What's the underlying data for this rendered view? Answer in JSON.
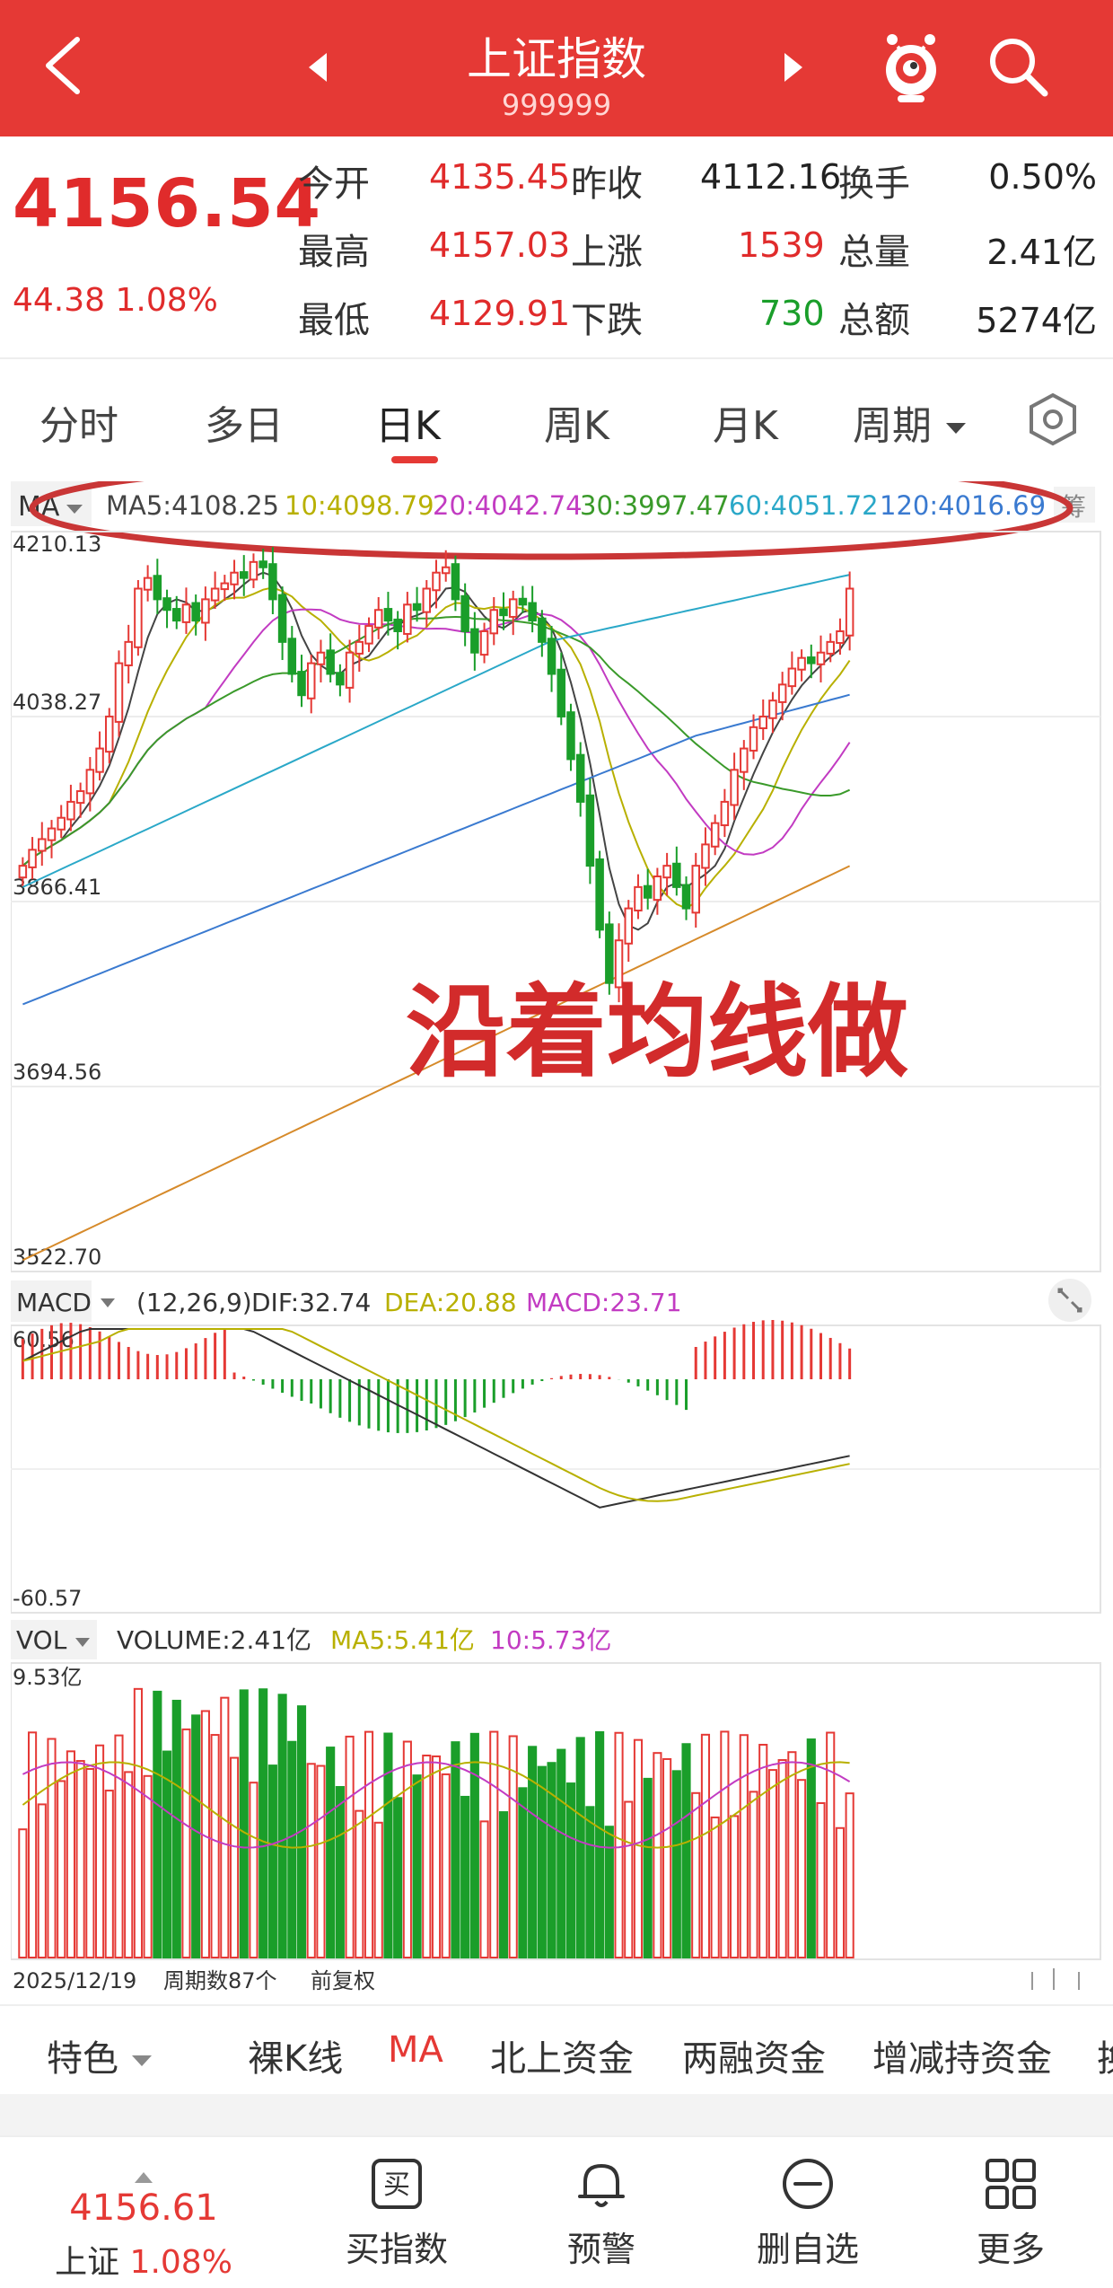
{
  "header": {
    "title": "上证指数",
    "code": "999999"
  },
  "quote": {
    "price": "4156.54",
    "change": "44.38 1.08%",
    "rows": [
      [
        {
          "label": "今开",
          "value": "4135.45",
          "color": "red"
        },
        {
          "label": "昨收",
          "value": "4112.16",
          "color": "dark"
        },
        {
          "label": "换手",
          "value": "0.50%",
          "color": "dark"
        }
      ],
      [
        {
          "label": "最高",
          "value": "4157.03",
          "color": "red"
        },
        {
          "label": "上涨",
          "value": "1539",
          "color": "red"
        },
        {
          "label": "总量",
          "value": "2.41亿",
          "color": "dark"
        }
      ],
      [
        {
          "label": "最低",
          "value": "4129.91",
          "color": "red"
        },
        {
          "label": "下跌",
          "value": "730",
          "color": "green"
        },
        {
          "label": "总额",
          "value": "5274亿",
          "color": "dark"
        }
      ]
    ]
  },
  "tabs": [
    "分时",
    "多日",
    "日K",
    "周K",
    "月K",
    "周期"
  ],
  "active_tab": "日K",
  "ma_legend": {
    "selector": "MA",
    "items": [
      "MA5:4108.25",
      "10:4098.79",
      "20:4042.74",
      "30:3997.47",
      "60:4051.72",
      "120:4016.69"
    ],
    "colors": [
      "#444444",
      "#b8b000",
      "#c23bc2",
      "#3a9a2a",
      "#2aa8c8",
      "#3a7ad0"
    ],
    "tail": "筹"
  },
  "annotation": "沿着均线做",
  "chart_data": [
    {
      "type": "candlestick",
      "title": "",
      "y_ticks": [
        "4210.13",
        "4038.27",
        "3866.41",
        "3694.56",
        "3522.70"
      ],
      "ylim": [
        3522.7,
        4210.13
      ],
      "bars": 87,
      "highlight": "MA legend circled",
      "closes": [
        3900,
        3915,
        3925,
        3935,
        3945,
        3960,
        3970,
        3990,
        4010,
        4040,
        4090,
        4110,
        4160,
        4170,
        4150,
        4140,
        4130,
        4145,
        4130,
        4150,
        4160,
        4165,
        4175,
        4170,
        4185,
        4180,
        4150,
        4110,
        4080,
        4060,
        4090,
        4100,
        4080,
        4070,
        4100,
        4110,
        4125,
        4140,
        4130,
        4120,
        4145,
        4140,
        4160,
        4175,
        4180,
        4150,
        4120,
        4100,
        4120,
        4140,
        4135,
        4150,
        4145,
        4130,
        4110,
        4080,
        4040,
        4000,
        3960,
        3900,
        3840,
        3790,
        3830,
        3860,
        3880,
        3870,
        3890,
        3900,
        3880,
        3860,
        3900,
        3920,
        3940,
        3960,
        3990,
        4010,
        4030,
        4040,
        4055,
        4070,
        4085,
        4095,
        4090,
        4100,
        4110,
        4120,
        4160
      ]
    },
    {
      "type": "macd",
      "title": "",
      "params": "(12,26,9)",
      "dif_label": "DIF:32.74",
      "dea_label": "DEA:20.88",
      "macd_label": "MACD:23.71",
      "y_ticks": [
        "60.56",
        "-60.57"
      ],
      "ylim": [
        -60.57,
        60.56
      ]
    },
    {
      "type": "bar",
      "title": "",
      "volume_label": "VOLUME:2.41亿",
      "ma5_label": "MA5:5.41亿",
      "ma10_label": "10:5.73亿",
      "y_ticks": [
        "9.53亿"
      ],
      "ylim": [
        0,
        9.53
      ]
    }
  ],
  "macd_selector": "MACD",
  "vol_selector": "VOL",
  "footer_date": "2025/12/19",
  "footer_period": "周期数87个",
  "footer_adjust": "前复权",
  "indicators": [
    "特色",
    "裸K线",
    "MA",
    "北上资金",
    "两融资金",
    "增减持资金",
    "换"
  ],
  "active_indicator": "MA",
  "nav": {
    "price": "4156.61",
    "index_label": "上证",
    "index_pct": "1.08%",
    "items": [
      "买指数",
      "预警",
      "删自选",
      "更多"
    ],
    "buy_glyph": "买"
  },
  "colors": {
    "up": "#e53935",
    "down": "#1a9e2a",
    "header": "#e53935"
  }
}
